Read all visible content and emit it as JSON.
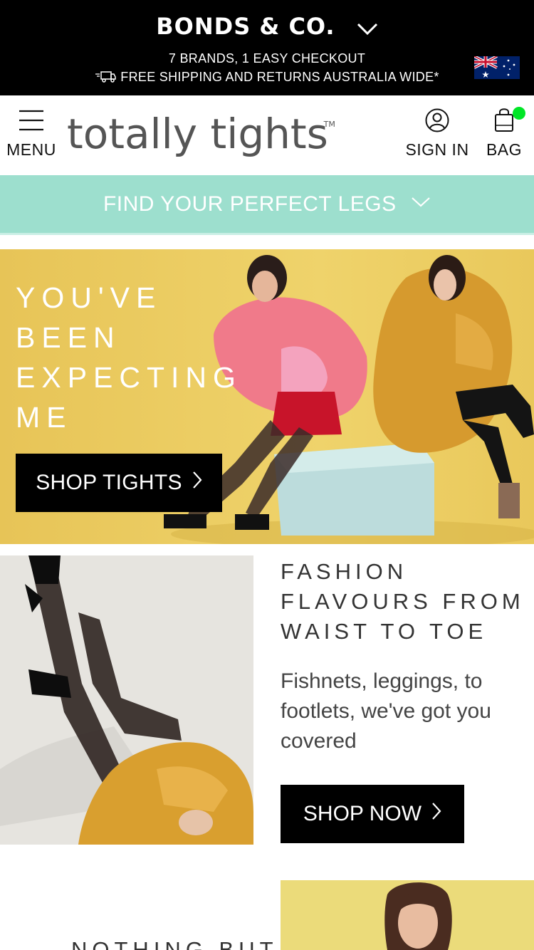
{
  "topbar": {
    "brand": "BONDS & CO.",
    "brand_dropdown_icon": "chevron-down-icon",
    "promo_line1": "7 BRANDS, 1 EASY CHECKOUT",
    "promo_line2": "FREE SHIPPING AND RETURNS AUSTRALIA WIDE*",
    "shipping_icon": "truck-icon",
    "region_flag": "australia-flag-icon"
  },
  "header": {
    "menu_label": "MENU",
    "menu_icon": "hamburger-icon",
    "logo_text": "totally tights",
    "logo_trademark": "TM",
    "signin_label": "SIGN IN",
    "signin_icon": "user-icon",
    "bag_label": "BAG",
    "bag_icon": "shopping-bag-icon",
    "bag_indicator_color": "#00e626"
  },
  "finder": {
    "label": "FIND YOUR PERFECT LEGS",
    "icon": "chevron-down-icon",
    "background": "#9ddfce"
  },
  "hero": {
    "title_lines": [
      "YOU'VE",
      "BEEN",
      "EXPECTING",
      "ME"
    ],
    "button_label": "SHOP TIGHTS",
    "button_icon": "chevron-right-icon",
    "background": "#e9c85b"
  },
  "feature": {
    "title_lines": [
      "FASHION",
      "FLAVOURS FROM",
      "WAIST TO TOE"
    ],
    "description": "Fishnets, leggings, to footlets, we've got you covered",
    "button_label": "SHOP NOW",
    "button_icon": "chevron-right-icon"
  },
  "feature2": {
    "title": "NOTHING BUT"
  }
}
